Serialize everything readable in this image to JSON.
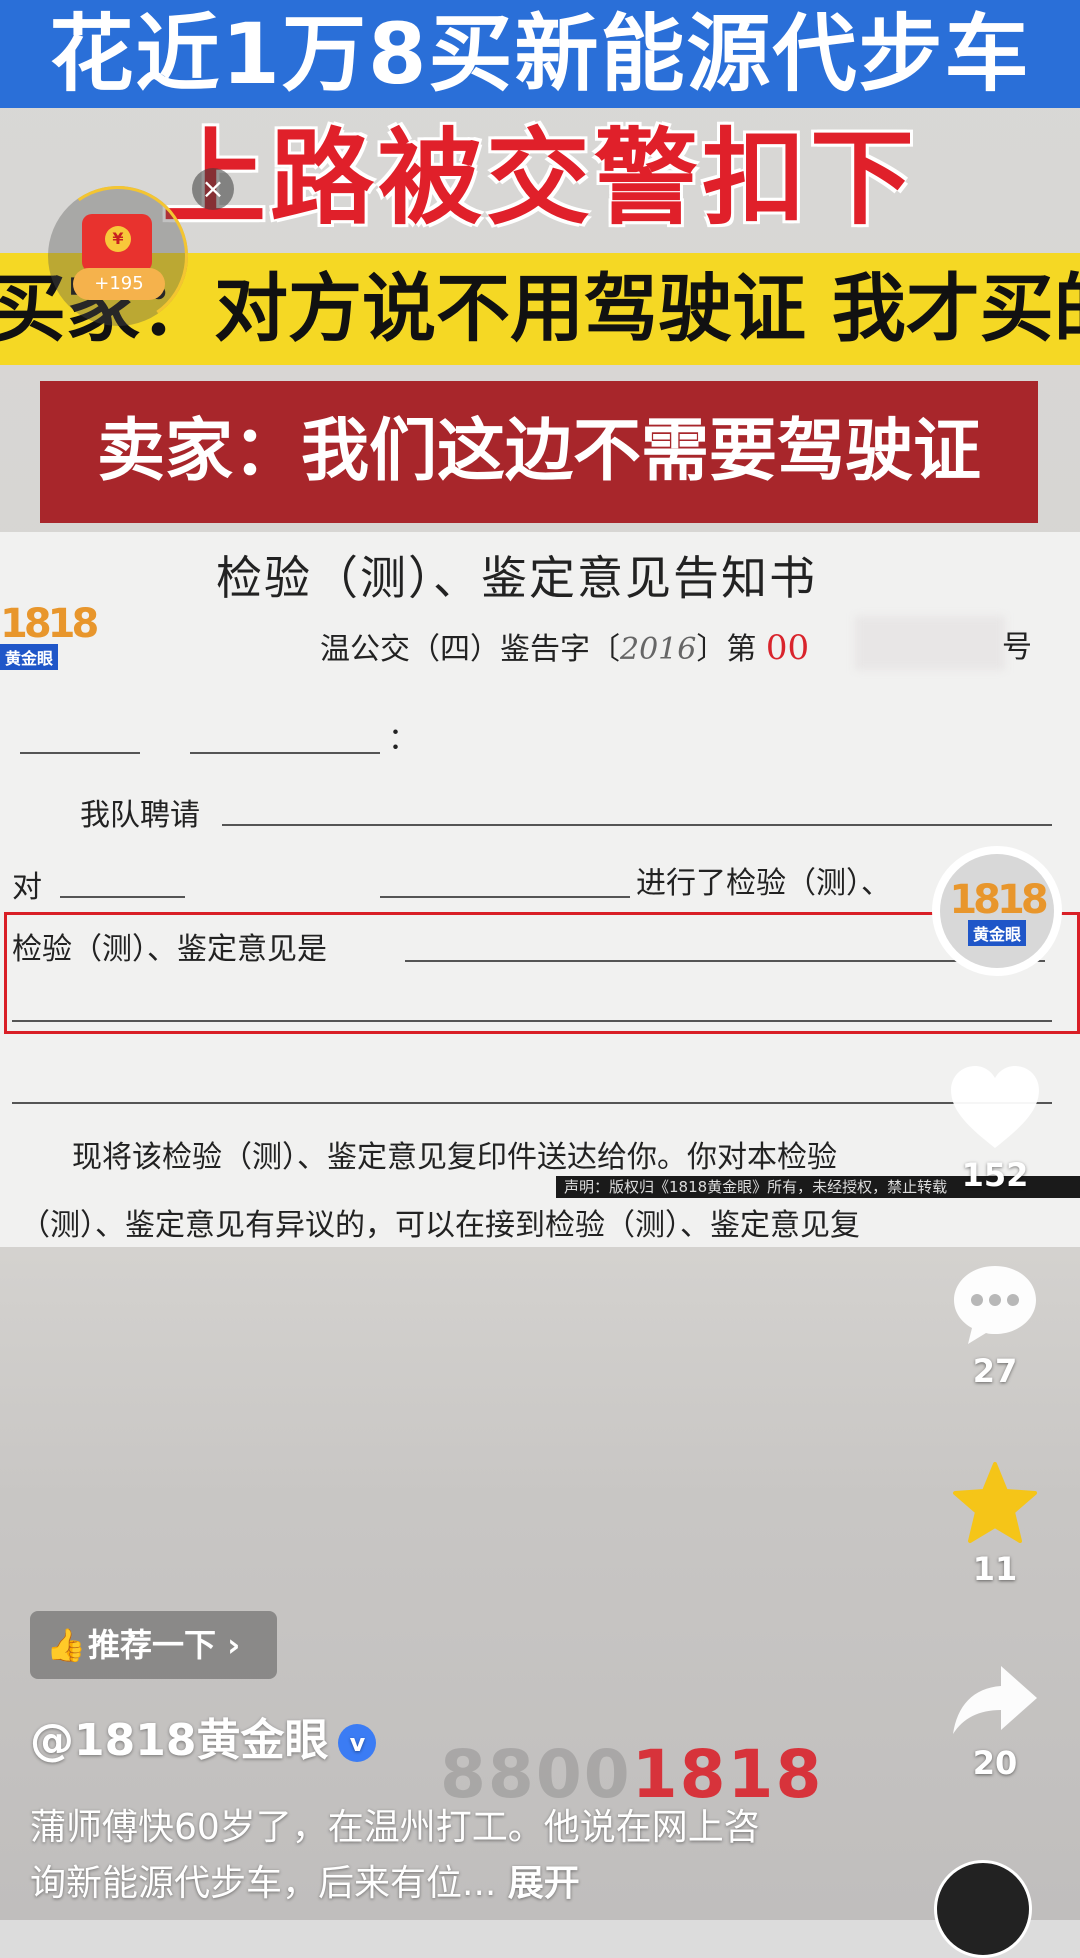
{
  "video": {
    "banner_title": "花近1万8买新能源代步车",
    "banner_subtitle": "上路被交警扣下",
    "banner_buyer": "买家：对方说不用驾驶证 我才买的",
    "banner_seller": "卖家：我们这边不需要驾驶证"
  },
  "document": {
    "title": "检验（测）、鉴定意见告知书",
    "number_prefix": "温公交（四）鉴告字〔",
    "number_year": "2016",
    "number_mid": "〕第",
    "number_red": "00",
    "number_suffix": "号",
    "addressee_colon": "：",
    "line_invite": "我队聘请",
    "line_object": "对",
    "line_object_tail": "进行了检验（测）、",
    "line_opinion": "检验（测）、鉴定意见是",
    "line_notice1": "现将该检验（测）、鉴定意见复印件送达给你。你对本检验",
    "line_notice2": "（测）、鉴定意见有异议的，可以在接到检验（测）、鉴定意见复",
    "copyright": "声明：版权归《1818黄金眼》所有，未经授权，禁止转载"
  },
  "watermark": {
    "logo_number": "1818",
    "logo_text": "黄金眼",
    "hotline_gray": "8800",
    "hotline_red": "1818"
  },
  "red_packet": {
    "badge": "+195",
    "coin": "¥",
    "close": "×"
  },
  "rail": {
    "avatar_number": "1818",
    "avatar_text": "黄金眼",
    "likes": "152",
    "comments": "27",
    "favorites": "11",
    "shares": "20"
  },
  "info": {
    "recommend_label": "推荐一下",
    "author": "@1818黄金眼",
    "verified": "v",
    "description": "蒲师傅快60岁了，在温州打工。他说在网上咨询新能源代步车，后来有位...",
    "expand": "展开"
  },
  "colors": {
    "banner_blue": "#2a6fd8",
    "banner_red_text": "#e0202a",
    "banner_yellow": "#f5d824",
    "banner_darkred": "#a8262b",
    "favorite_gold": "#f5c518"
  }
}
